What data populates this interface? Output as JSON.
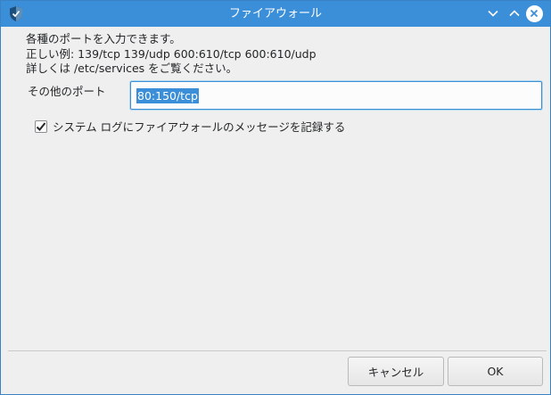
{
  "window": {
    "title": "ファイアウォール",
    "accent_color": "#3b8ed8",
    "app_icon": "shield-icon"
  },
  "description": {
    "line1": "各種のポートを入力できます。",
    "line2": "正しい例: 139/tcp 139/udp 600:610/tcp 600:610/udp",
    "line3": "詳しくは /etc/services をご覧ください。"
  },
  "form": {
    "other_ports_label": "その他のポート",
    "other_ports_value": "80:150/tcp",
    "log_checkbox_label": "システム ログにファイアウォールのメッセージを記録する",
    "log_checkbox_checked": true
  },
  "buttons": {
    "cancel": "キャンセル",
    "ok": "OK"
  }
}
